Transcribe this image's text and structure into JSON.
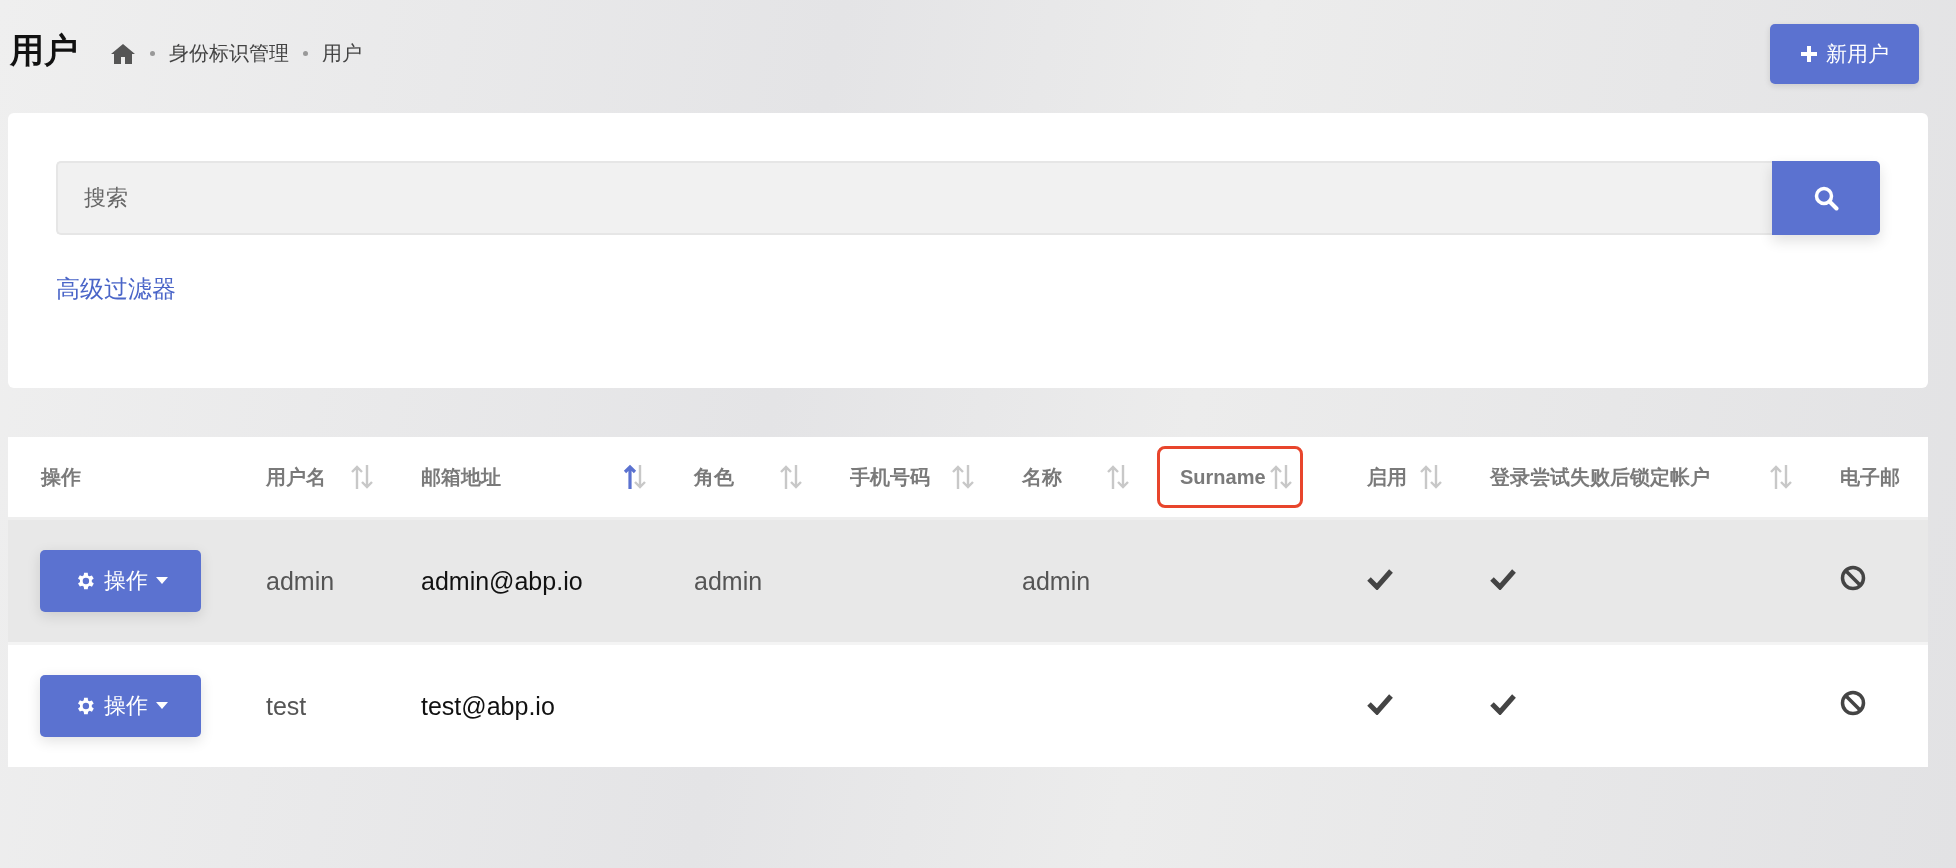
{
  "page": {
    "title": "用户",
    "breadcrumb": [
      "身份标识管理",
      "用户"
    ],
    "new_button": "新用户"
  },
  "filter": {
    "search": {
      "placeholder": "搜索"
    },
    "advanced_link": "高级过滤器"
  },
  "table": {
    "columns": [
      {
        "label": "操作",
        "highlighted": false
      },
      {
        "label": "用户名",
        "sortable": true,
        "sorted_ascending": false,
        "highlighted": false
      },
      {
        "label": "邮箱地址",
        "sortable": true,
        "sorted_ascending": true,
        "highlighted": false
      },
      {
        "label": "角色",
        "sortable": true,
        "sorted_ascending": false,
        "highlighted": false
      },
      {
        "label": "手机号码",
        "sortable": true,
        "sorted_ascending": false,
        "highlighted": false
      },
      {
        "label": "名称",
        "sortable": true,
        "sorted_ascending": false,
        "highlighted": false
      },
      {
        "label": "Surname",
        "sortable": true,
        "sorted_ascending": false,
        "highlighted": true
      },
      {
        "label": "启用",
        "sortable": true,
        "sorted_ascending": false,
        "highlighted": false
      },
      {
        "label": "登录尝试失败后锁定帐户",
        "sortable": true,
        "sorted_ascending": false,
        "highlighted": false
      },
      {
        "label": "电子邮"
      }
    ],
    "rows": [
      {
        "action": "操作",
        "username": "admin",
        "email": "admin@abp.io",
        "roles": "admin",
        "name": "admin",
        "enabled": true,
        "lockout_enabled": true,
        "email_confirmed": false
      },
      {
        "action": "操作",
        "username": "test",
        "email": "test@abp.io",
        "enabled": true,
        "lockout_enabled": true,
        "email_confirmed": false
      }
    ]
  }
}
